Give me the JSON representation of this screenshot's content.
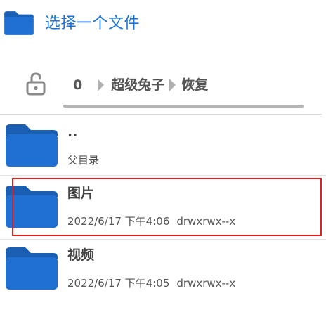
{
  "header": {
    "title": "选择一个文件",
    "icon": "folder-icon"
  },
  "path": {
    "lock_icon": "unlocked-padlock-icon",
    "crumbs": [
      "0",
      "超级兔子",
      "恢复"
    ]
  },
  "files": [
    {
      "name": "..",
      "meta": "父目录",
      "date": "",
      "perm": ""
    },
    {
      "name": "图片",
      "meta": "",
      "date": "2022/6/17 下午4:06",
      "perm": "drwxrwx--x"
    },
    {
      "name": "视频",
      "meta": "",
      "date": "2022/6/17 下午4:05",
      "perm": "drwxrwx--x"
    }
  ],
  "colors": {
    "accent": "#1e73d6",
    "folder": "#1f6fd0",
    "highlight": "#e02020"
  }
}
